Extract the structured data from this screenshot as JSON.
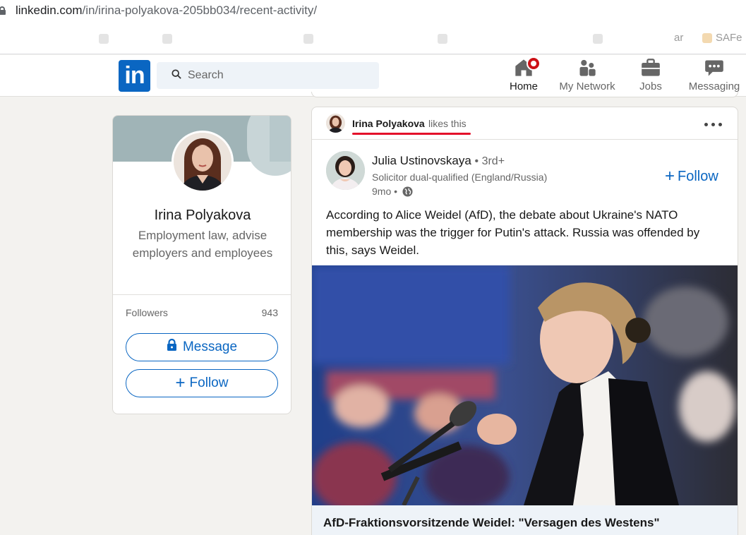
{
  "browser": {
    "url_host": "linkedin.com",
    "url_path": "/in/irina-polyakova-205bb034/recent-activity/",
    "bookmarks": [
      "",
      "",
      "",
      "",
      "",
      "ar",
      "SAFe"
    ]
  },
  "nav": {
    "logo": "in",
    "search_placeholder": "Search",
    "items": [
      {
        "label": "Home",
        "icon": "home-icon",
        "active": true
      },
      {
        "label": "My Network",
        "icon": "network-icon"
      },
      {
        "label": "Jobs",
        "icon": "briefcase-icon"
      },
      {
        "label": "Messaging",
        "icon": "messaging-icon"
      }
    ]
  },
  "profile": {
    "name": "Irina Polyakova",
    "headline": "Employment law, advise employers and employees",
    "followers_label": "Followers",
    "followers_count": "943",
    "message_label": "Message",
    "follow_label": "Follow"
  },
  "post": {
    "liker_name": "Irina Polyakova",
    "likes_text": "likes this",
    "author": {
      "name": "Julia Ustinovskaya",
      "degree": "• 3rd+",
      "headline": "Solicitor dual-qualified (England/Russia)",
      "time": "9mo •"
    },
    "follow_label": "Follow",
    "text": "According to Alice Weidel (AfD), the debate about Ukraine's NATO membership was the trigger for Putin's attack. Russia was offended by this, says Weidel.",
    "link_title": "AfD-Fraktionsvorsitzende Weidel: \"Versagen des Westens\""
  },
  "colors": {
    "brand": "#0a66c2",
    "background": "#f3f2ef",
    "highlight_underline": "#e4102a",
    "notification": "#cc1016"
  }
}
